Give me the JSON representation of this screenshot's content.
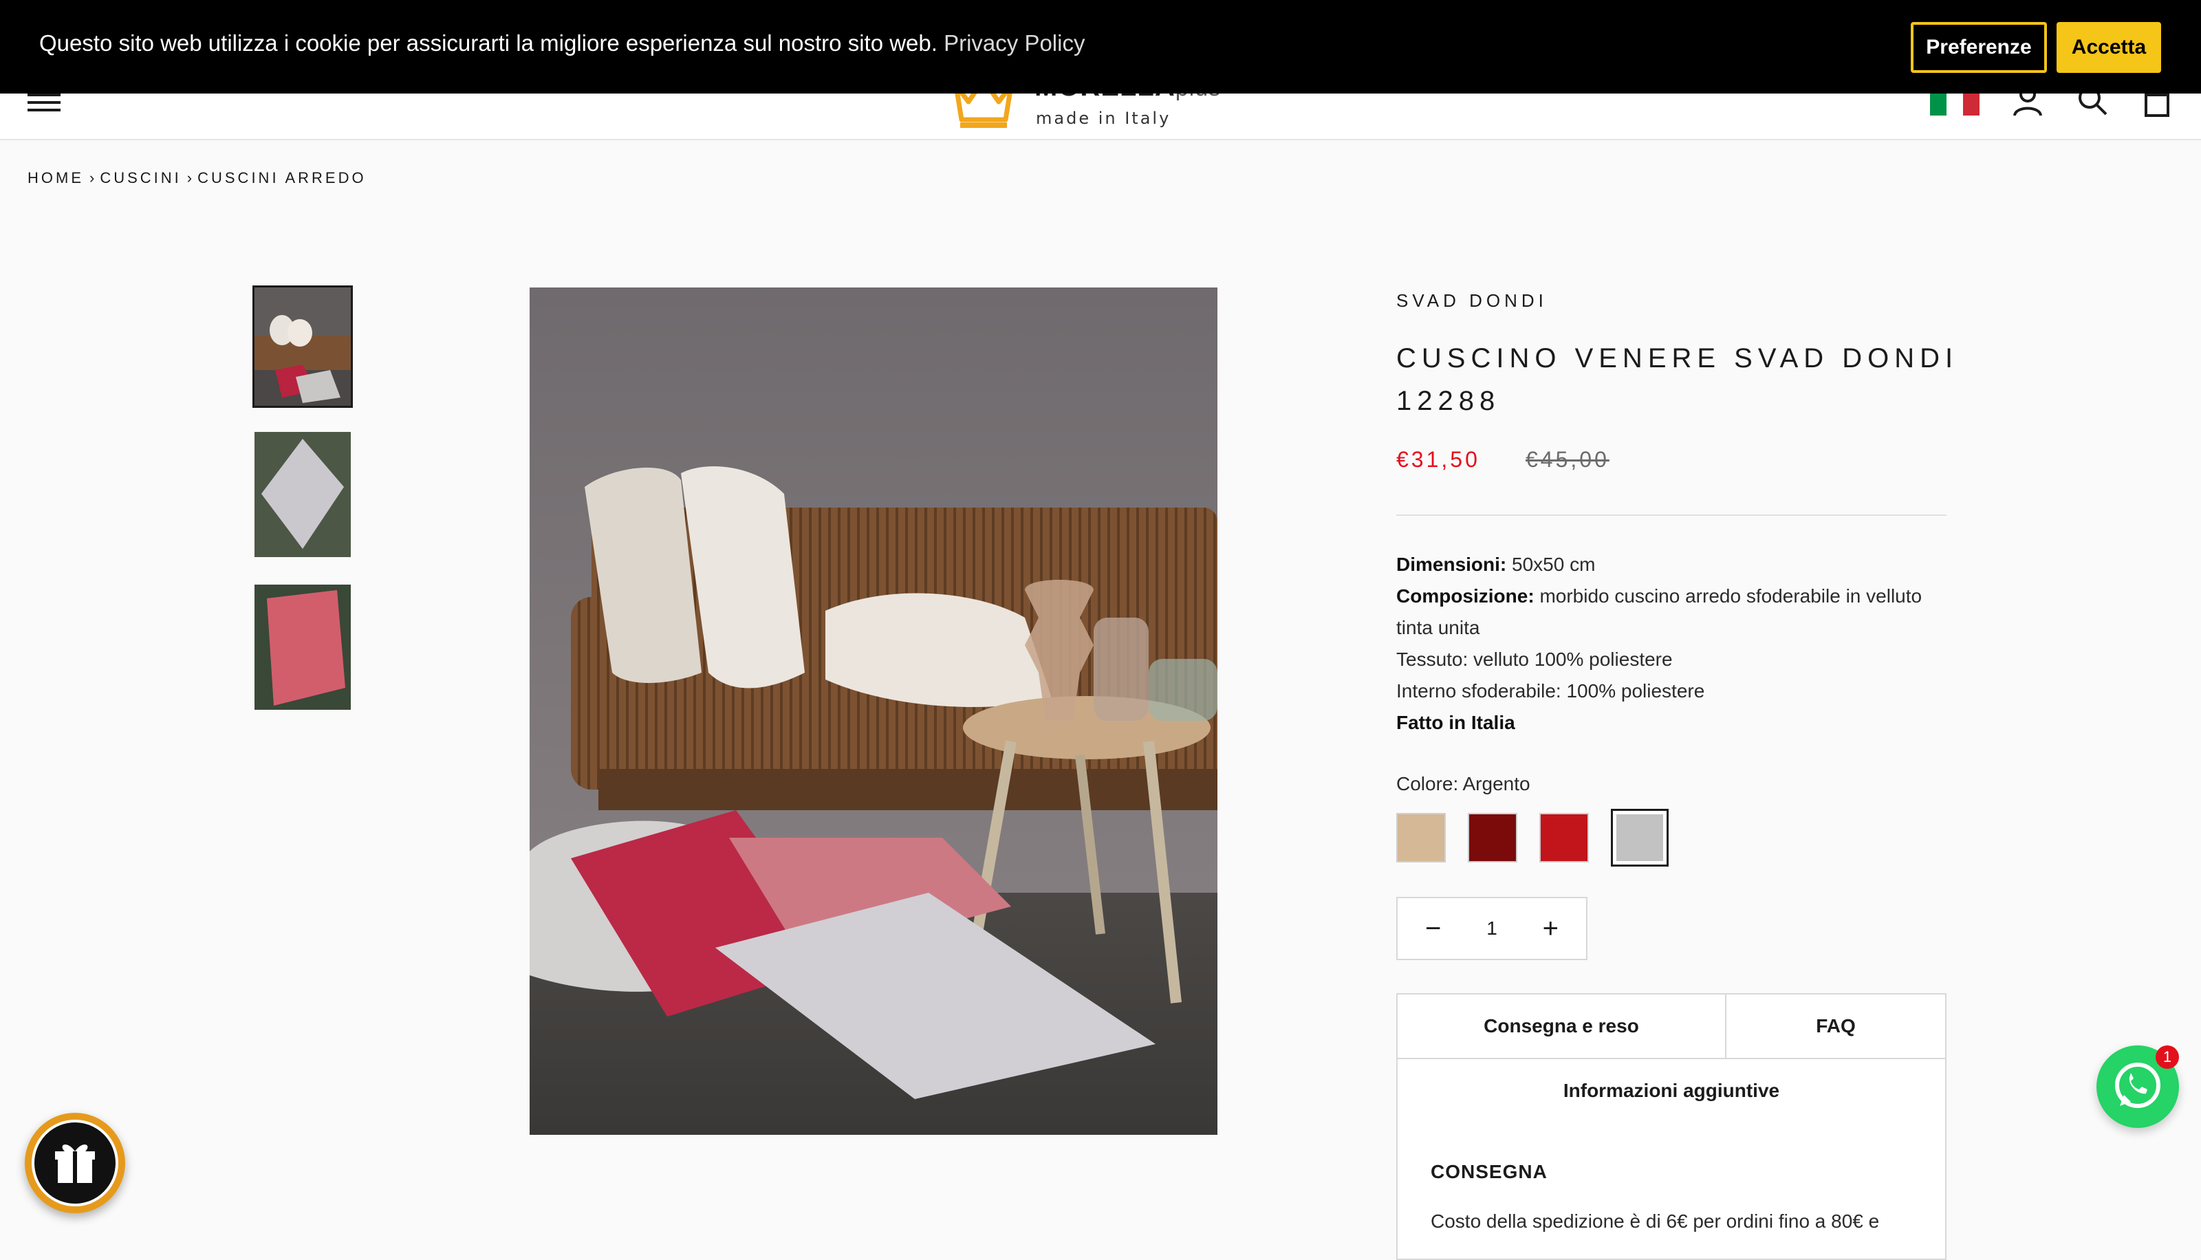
{
  "cookie": {
    "text": "Questo sito web utilizza i cookie per assicurarti la migliore esperienza sul nostro sito web.",
    "link": "Privacy Policy",
    "preferences_label": "Preferenze",
    "accept_label": "Accetta",
    "accent_color": "#f5c518"
  },
  "header": {
    "logo_name": "MORELLA",
    "logo_suffix": "plus",
    "logo_tagline": "made in Italy",
    "icons": [
      "menu-icon",
      "italy-flag-icon",
      "account-icon",
      "search-icon",
      "cart-icon"
    ]
  },
  "breadcrumb": [
    "HOME",
    "CUSCINI",
    "CUSCINI ARREDO"
  ],
  "product": {
    "brand": "SVAD DONDI",
    "title": "CUSCINO VENERE SVAD DONDI 12288",
    "price": "€31,50",
    "price_old": "€45,00",
    "desc": [
      {
        "label": "Dimensioni:",
        "text": " 50x50 cm"
      },
      {
        "label": "Composizione:",
        "text": " morbido cuscino arredo sfoderabile in velluto tinta unita"
      },
      {
        "label": "",
        "text": "Tessuto: velluto 100% poliestere"
      },
      {
        "label": "",
        "text": "Interno sfoderabile: 100% poliestere"
      },
      {
        "label": "Fatto in Italia",
        "text": ""
      }
    ],
    "color_label": "Colore: Argento",
    "swatches": [
      "#d5b896",
      "#7b0a0a",
      "#c1141b",
      "#c2c2c2"
    ],
    "selected_swatch": 3,
    "quantity": "1",
    "tabs": [
      "Consegna e reso",
      "FAQ",
      "Informazioni aggiuntive"
    ],
    "panel_title": "CONSEGNA",
    "panel_text": "Costo della spedizione è di 6€ per ordini fino a 80€ e"
  },
  "whatsapp_badge": "1",
  "colors": {
    "sale_price": "#e3101b",
    "whatsapp": "#25d366",
    "gift_ring": "#e69a1c"
  }
}
